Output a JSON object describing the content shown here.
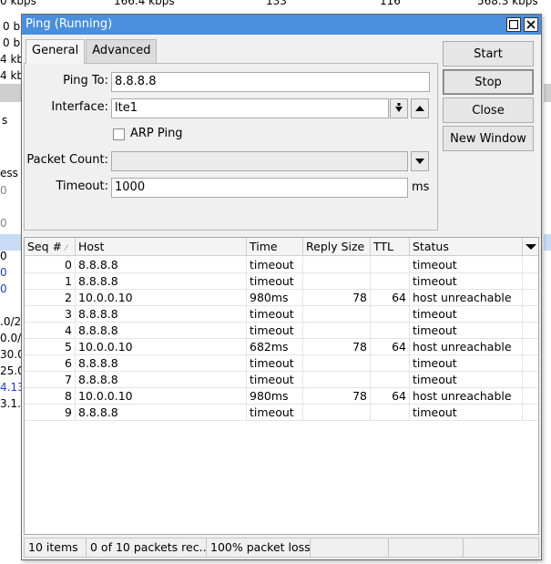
{
  "background": {
    "top_values": [
      "0 kbps",
      "166.4 kbps",
      "133",
      "116",
      "568.3 kbps"
    ],
    "left_fragments": [
      "0 b",
      "0 b",
      "4 kb",
      "4 kb",
      "s",
      "ess",
      "0",
      "0",
      "0",
      "0",
      "0",
      "0/24",
      ".0/2",
      "0.0/",
      "30.0",
      "25.0",
      "4.13",
      "3.1.0"
    ]
  },
  "window": {
    "title": "Ping (Running)",
    "tabs": [
      "General",
      "Advanced"
    ],
    "form": {
      "ping_to_label": "Ping To:",
      "ping_to_value": "8.8.8.8",
      "interface_label": "Interface:",
      "interface_value": "lte1",
      "arp_ping_label": "ARP Ping",
      "packet_count_label": "Packet Count:",
      "packet_count_value": "",
      "timeout_label": "Timeout:",
      "timeout_value": "1000",
      "timeout_unit": "ms"
    },
    "buttons": {
      "start": "Start",
      "stop": "Stop",
      "close": "Close",
      "new_window": "New Window"
    }
  },
  "table": {
    "columns": [
      "Seq #",
      "Host",
      "Time",
      "Reply Size",
      "TTL",
      "Status"
    ],
    "rows": [
      {
        "seq": "0",
        "host": "8.8.8.8",
        "time": "timeout",
        "reply_size": "",
        "ttl": "",
        "status": "timeout"
      },
      {
        "seq": "1",
        "host": "8.8.8.8",
        "time": "timeout",
        "reply_size": "",
        "ttl": "",
        "status": "timeout"
      },
      {
        "seq": "2",
        "host": "10.0.0.10",
        "time": "980ms",
        "reply_size": "78",
        "ttl": "64",
        "status": "host unreachable"
      },
      {
        "seq": "3",
        "host": "8.8.8.8",
        "time": "timeout",
        "reply_size": "",
        "ttl": "",
        "status": "timeout"
      },
      {
        "seq": "4",
        "host": "8.8.8.8",
        "time": "timeout",
        "reply_size": "",
        "ttl": "",
        "status": "timeout"
      },
      {
        "seq": "5",
        "host": "10.0.0.10",
        "time": "682ms",
        "reply_size": "78",
        "ttl": "64",
        "status": "host unreachable"
      },
      {
        "seq": "6",
        "host": "8.8.8.8",
        "time": "timeout",
        "reply_size": "",
        "ttl": "",
        "status": "timeout"
      },
      {
        "seq": "7",
        "host": "8.8.8.8",
        "time": "timeout",
        "reply_size": "",
        "ttl": "",
        "status": "timeout"
      },
      {
        "seq": "8",
        "host": "10.0.0.10",
        "time": "980ms",
        "reply_size": "78",
        "ttl": "64",
        "status": "host unreachable"
      },
      {
        "seq": "9",
        "host": "8.8.8.8",
        "time": "timeout",
        "reply_size": "",
        "ttl": "",
        "status": "timeout"
      }
    ]
  },
  "statusbar": {
    "items": "10 items",
    "received": "0 of 10 packets rec...",
    "loss": "100% packet loss"
  },
  "colors": {
    "titlebar": "#4a8fdb",
    "background_selected_row": "#c8dcf5"
  }
}
